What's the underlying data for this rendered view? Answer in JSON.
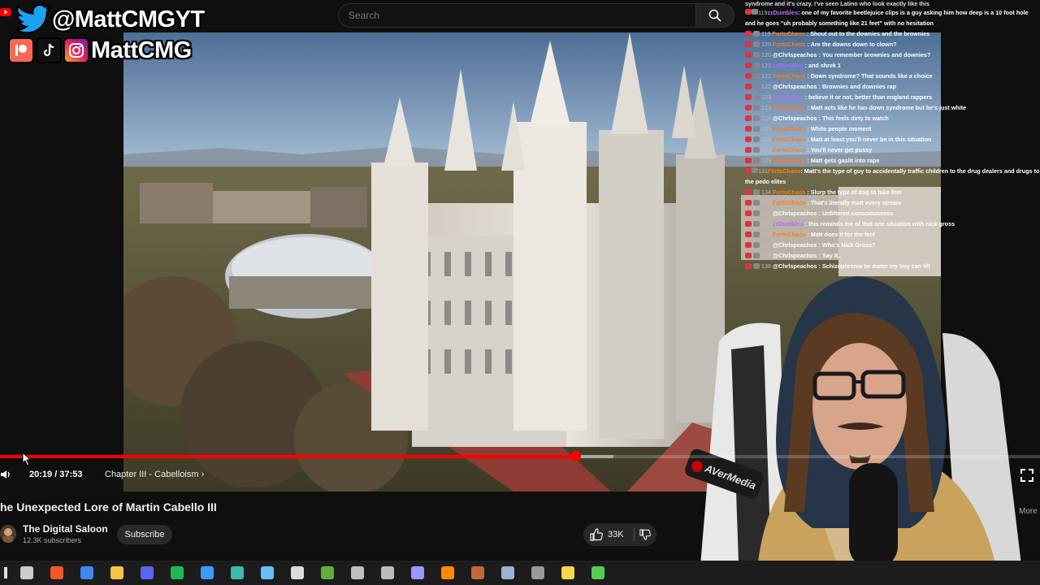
{
  "search": {
    "placeholder": "Search"
  },
  "overlay": {
    "twitter_handle": "@MattCMGYT",
    "social_handle": "MattCMG"
  },
  "player": {
    "current_time": "20:19",
    "duration": "37:53",
    "time_text": "20:19 / 37:53",
    "chapter": "Chapter III - Cabelloism",
    "played_fraction": 0.553,
    "loaded_fraction": 0.59
  },
  "video": {
    "title": "he Unexpected Lore of Martin Cabello III",
    "channel_name": "The Digital Saloon",
    "subscribers": "12.3K subscribers",
    "subscribe_label": "Subscribe",
    "like_count": "33K",
    "more_label": "More"
  },
  "chat": {
    "top_fragment": "syndrome and it's crazy. I've seen Latino who look exactly like this",
    "messages": [
      {
        "level": "119",
        "user": "zzDumbles",
        "color": "#b36bff",
        "text": "one of my favorite beetlejuice clips is a guy asking him how deep is a 10 foot hole and he goes \"uh probably something like 21 feet\" with no hesitation"
      },
      {
        "level": "119",
        "user": "FortoChaos",
        "color": "#ff7a1a",
        "text": "Shout out to the downies and the brownies"
      },
      {
        "level": "120",
        "user": "FortoChaos",
        "color": "#ff7a1a",
        "text": "Are the downs down to clown?"
      },
      {
        "level": "120",
        "user": "@Chrlspeachos",
        "color": "#ffffff",
        "text": "You remember brownies and downies?"
      },
      {
        "level": "121",
        "user": "zzDumbles",
        "color": "#b36bff",
        "text": "and shrek 1"
      },
      {
        "level": "122",
        "user": "FortoChaos",
        "color": "#ff7a1a",
        "text": "Down syndrome? That sounds like a choice"
      },
      {
        "level": "122",
        "user": "@Chrlspeachos",
        "color": "#ffffff",
        "text": "Brownies and downies rap"
      },
      {
        "level": "123",
        "user": "zzDumbles",
        "color": "#b36bff",
        "text": "believe it or not, better than england rappers"
      },
      {
        "level": "123",
        "user": "FortoChaos",
        "color": "#ff7a1a",
        "text": "Matt acts like he has down syndrome but he's just white"
      },
      {
        "level": "124",
        "user": "@Chrlspeachos",
        "color": "#ffffff",
        "text": "This feels dirty to watch"
      },
      {
        "level": "125",
        "user": "FortoChaos",
        "color": "#ff7a1a",
        "text": "White people moment"
      },
      {
        "level": "126",
        "user": "FortoChaos",
        "color": "#ff7a1a",
        "text": "Matt at least you'll never be in this situation"
      },
      {
        "level": "127",
        "user": "FortoChaos",
        "color": "#ff7a1a",
        "text": "You'll never get pussy"
      },
      {
        "level": "129",
        "user": "FortoChaos",
        "color": "#ff7a1a",
        "text": "Matt gets gaslit into rape"
      },
      {
        "level": "131",
        "user": "FortoChaos",
        "color": "#ff7a1a",
        "text": "Matt's the type of guy to accidentally traffic children to the drug dealers and drugs to the pedo elites"
      },
      {
        "level": "134",
        "user": "FortoChaos",
        "color": "#ff7a1a",
        "text": "Slurp the type of dog to take feet"
      },
      {
        "level": "134",
        "user": "FortoChaos",
        "color": "#ff7a1a",
        "text": "That's literally matt every stream"
      },
      {
        "level": "136",
        "user": "@Chrlspeachos",
        "color": "#ffffff",
        "text": "Unfiltered consciousness"
      },
      {
        "level": "138",
        "user": "zzDumbles",
        "color": "#b36bff",
        "text": "this reminds me of that one situation with nick gross"
      },
      {
        "level": "138",
        "user": "FortoChaos",
        "color": "#ff7a1a",
        "text": "Matt does it for the feet"
      },
      {
        "level": "138",
        "user": "@Chrlspeachos",
        "color": "#ffffff",
        "text": "Who's Nick Gross?"
      },
      {
        "level": "138",
        "user": "@Chrlspeachos",
        "color": "#ffffff",
        "text": "Say it.."
      },
      {
        "level": "138",
        "user": "@Chrlspeachos",
        "color": "#ffffff",
        "text": "Schizophrenia be damn my boy can lift"
      }
    ]
  },
  "taskbar": {
    "icons": [
      {
        "name": "task-view-icon",
        "color": "#cccccc"
      },
      {
        "name": "brave-icon",
        "color": "#fb542b"
      },
      {
        "name": "chrome-icon",
        "color": "#4285f4"
      },
      {
        "name": "file-explorer-icon",
        "color": "#f4c542"
      },
      {
        "name": "discord-icon",
        "color": "#5865f2"
      },
      {
        "name": "spotify-icon",
        "color": "#1db954"
      },
      {
        "name": "droplet-icon",
        "color": "#3b9cff"
      },
      {
        "name": "vpn-icon",
        "color": "#3fb8af"
      },
      {
        "name": "steam-icon",
        "color": "#66c0f4"
      },
      {
        "name": "epic-games-icon",
        "color": "#dddddd"
      },
      {
        "name": "minecraft-icon",
        "color": "#5fae3c"
      },
      {
        "name": "shield-app-icon",
        "color": "#c0c0c0"
      },
      {
        "name": "obs-icon",
        "color": "#bbbbbb"
      },
      {
        "name": "premiere-icon",
        "color": "#9999ff"
      },
      {
        "name": "app-orange-icon",
        "color": "#ff8a00"
      },
      {
        "name": "app-brown-icon",
        "color": "#c06a3a"
      },
      {
        "name": "app-document-icon",
        "color": "#9ab3d6"
      },
      {
        "name": "app-circle-icon",
        "color": "#999999"
      },
      {
        "name": "sticky-notes-icon",
        "color": "#f7d84a"
      },
      {
        "name": "app-green-icon",
        "color": "#55cc55"
      }
    ]
  }
}
